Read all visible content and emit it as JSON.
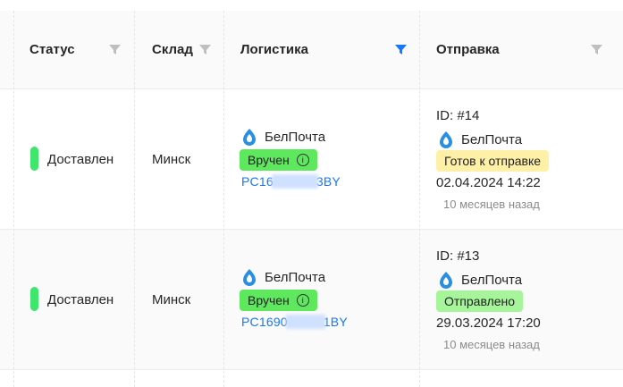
{
  "columns": [
    {
      "label": "Статус"
    },
    {
      "label": "Склад"
    },
    {
      "label": "Логистика"
    },
    {
      "label": "Отправка"
    }
  ],
  "colors": {
    "filter_active": "#1677ff",
    "filter_inactive": "#bfbfbf",
    "status_green": "#3ee66b"
  },
  "rows": [
    {
      "status": "Доставлен",
      "warehouse": "Минск",
      "carrier": "БелПочта",
      "delivery_badge": "Вручен",
      "tracking_start": "PC16",
      "tracking_end": "3BY",
      "shipment_id": "ID:  #14",
      "shipment_carrier": "БелПочта",
      "shipment_status": "Готов к отправке",
      "shipment_date": "02.04.2024 14:22",
      "shipment_ago": "10 месяцев назад"
    },
    {
      "status": "Доставлен",
      "warehouse": "Минск",
      "carrier": "БелПочта",
      "delivery_badge": "Вручен",
      "tracking_start": "PC1690",
      "tracking_end": "1BY",
      "shipment_id": "ID:  #13",
      "shipment_carrier": "БелПочта",
      "shipment_status": "Отправлено",
      "shipment_date": "29.03.2024 17:20",
      "shipment_ago": "10 месяцев назад"
    }
  ]
}
